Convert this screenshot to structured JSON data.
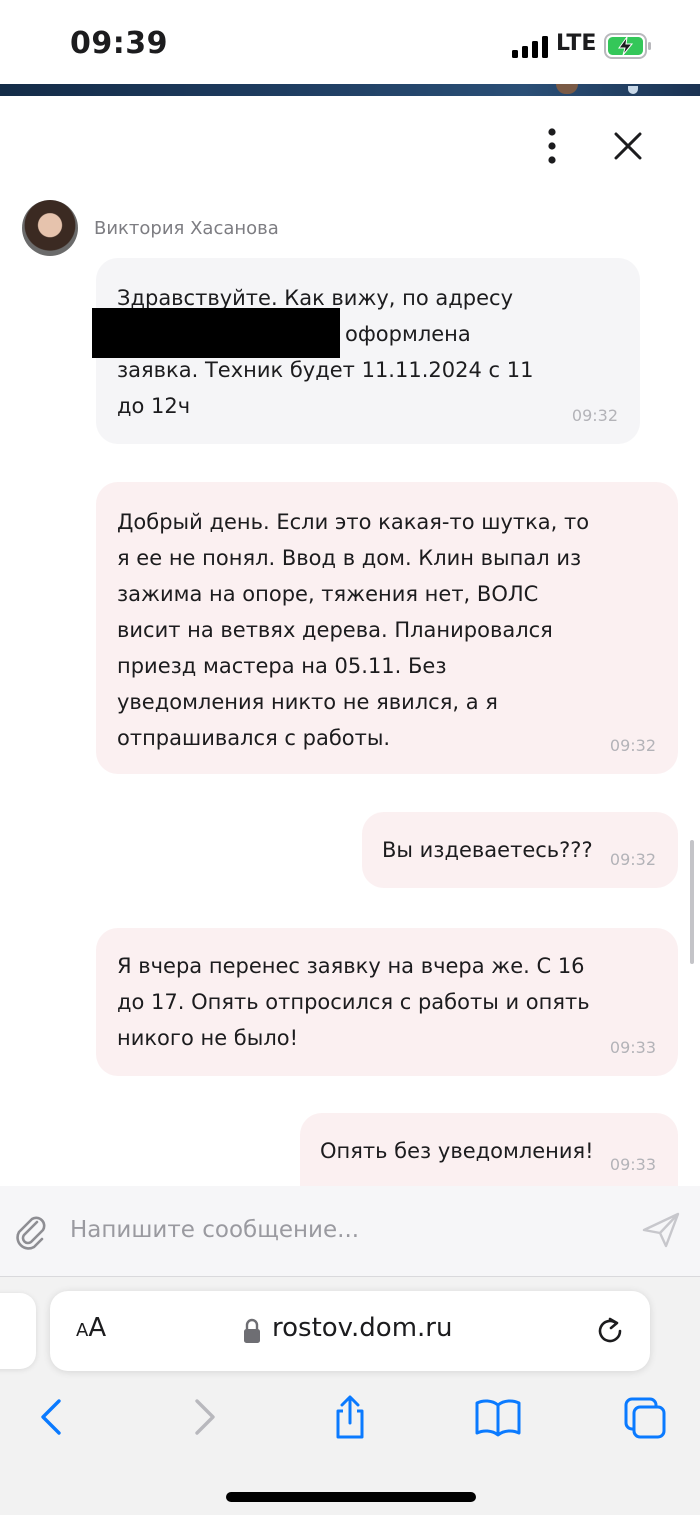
{
  "status_bar": {
    "time": "09:39",
    "network": "LTE",
    "signal_icon": "cellular-signal-icon",
    "battery_icon": "battery-charging-icon"
  },
  "chat": {
    "header": {
      "more_icon": "more-vertical-icon",
      "close_icon": "close-icon"
    },
    "agent": {
      "name": "Виктория Хасанова"
    },
    "messages": [
      {
        "direction": "incoming",
        "text_line1": "Здравствуйте. Как вижу, по адресу",
        "text_line2": "оформлена",
        "text_rest": "заявка. Техник будет 11.11.2024 с 11\nдо 12ч",
        "time": "09:32"
      },
      {
        "direction": "outgoing",
        "text": "Добрый день. Если это какая-то шутка, то\nя ее не понял. Ввод в дом. Клин выпал из\nзажима на опоре, тяжения нет, ВОЛС\nвисит на ветвях дерева. Планировался\nприезд мастера на 05.11. Без\nуведомления никто не явился, а я\nотпрашивался с работы.",
        "time": "09:32"
      },
      {
        "direction": "outgoing",
        "text": "Вы издеваетесь???",
        "time": "09:32"
      },
      {
        "direction": "outgoing",
        "text": "Я вчера перенес заявку на вчера же. С 16\nдо 17. Опять отпросился с работы и опять\nникого не было!",
        "time": "09:33"
      },
      {
        "direction": "outgoing",
        "text": "Опять без уведомления!",
        "time": "09:33"
      }
    ],
    "composer": {
      "placeholder": "Напишите сообщение...",
      "value": "",
      "attach_icon": "paperclip-icon",
      "send_icon": "send-icon"
    }
  },
  "browser": {
    "text_size_label_small": "A",
    "text_size_label_large": "A",
    "url": "rostov.dom.ru",
    "lock_icon": "lock-icon",
    "reload_icon": "reload-icon",
    "toolbar": [
      "back-icon",
      "forward-icon",
      "share-icon",
      "bookmarks-icon",
      "tabs-icon"
    ]
  },
  "colors": {
    "incoming_bubble": "#f5f5f7",
    "outgoing_bubble": "#fbf0f1",
    "safari_blue": "#0a7aff",
    "muted_text": "#7d7d82"
  }
}
